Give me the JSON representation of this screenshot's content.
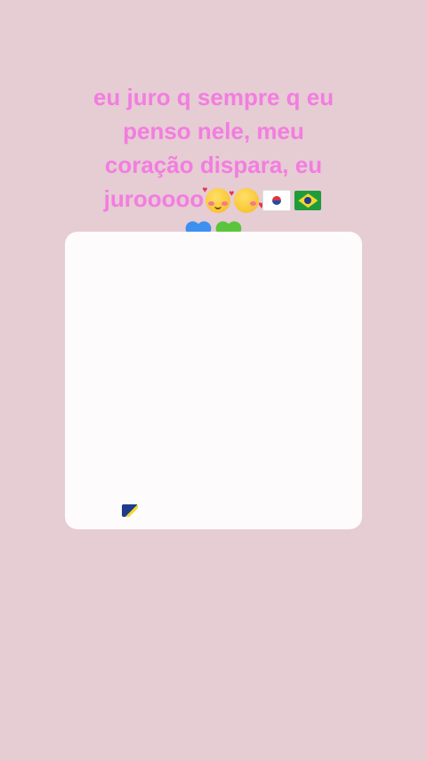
{
  "story": {
    "line1": "eu juro q sempre q eu",
    "line2": "penso nele, meu",
    "line3": "coração dispara, eu",
    "line4_text": "jurooooo",
    "line4_emojis": [
      "smiling-face-with-hearts",
      "face-blowing-kiss",
      "south-korea-flag",
      "brazil-flag"
    ],
    "line5_emojis": [
      "blue-heart",
      "green-heart"
    ]
  },
  "colors": {
    "background": "#e6ccd3",
    "text": "#f27de0",
    "card": "#fdfbfb"
  }
}
